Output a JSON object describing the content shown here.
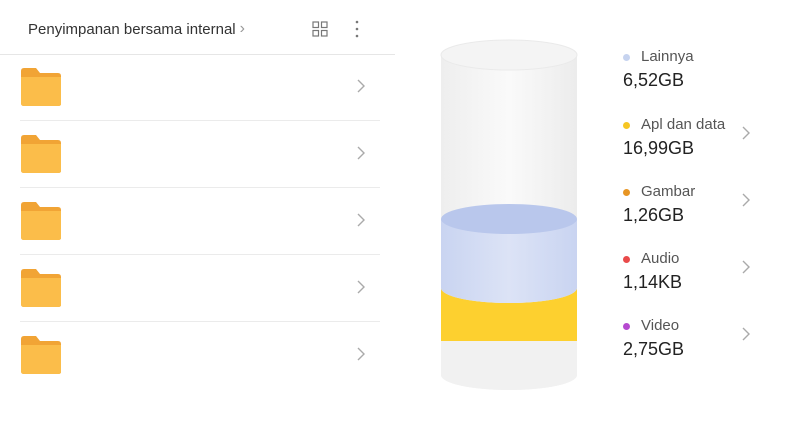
{
  "header": {
    "breadcrumb_label": "Penyimpanan bersama internal",
    "grid_icon": "grid-view-icon",
    "more_icon": "more-vertical-icon"
  },
  "folders": [
    {
      "icon": "folder-icon"
    },
    {
      "icon": "folder-icon"
    },
    {
      "icon": "folder-icon"
    },
    {
      "icon": "folder-icon"
    },
    {
      "icon": "folder-icon"
    }
  ],
  "storage": {
    "categories": [
      {
        "name": "Lainnya",
        "size": "6,52GB",
        "color": "#c6d3ef",
        "has_arrow": false
      },
      {
        "name": "Apl dan data",
        "size": "16,99GB",
        "color": "#f6c623",
        "has_arrow": true
      },
      {
        "name": "Gambar",
        "size": "1,26GB",
        "color": "#e79524",
        "has_arrow": true
      },
      {
        "name": "Audio",
        "size": "1,14KB",
        "color": "#e94a4a",
        "has_arrow": true
      },
      {
        "name": "Video",
        "size": "2,75GB",
        "color": "#b64ad0",
        "has_arrow": true
      }
    ]
  }
}
